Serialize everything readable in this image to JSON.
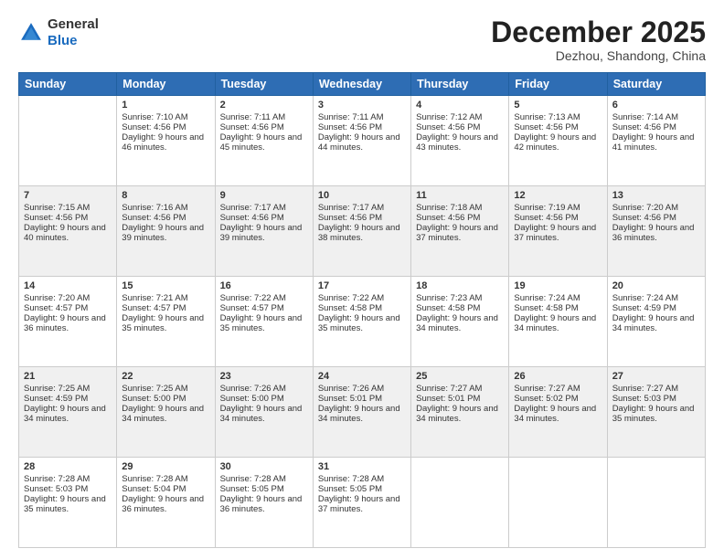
{
  "header": {
    "logo_line1": "General",
    "logo_line2": "Blue",
    "month_title": "December 2025",
    "location": "Dezhou, Shandong, China"
  },
  "days_of_week": [
    "Sunday",
    "Monday",
    "Tuesday",
    "Wednesday",
    "Thursday",
    "Friday",
    "Saturday"
  ],
  "weeks": [
    [
      {
        "day": "",
        "sunrise": "",
        "sunset": "",
        "daylight": ""
      },
      {
        "day": "1",
        "sunrise": "Sunrise: 7:10 AM",
        "sunset": "Sunset: 4:56 PM",
        "daylight": "Daylight: 9 hours and 46 minutes."
      },
      {
        "day": "2",
        "sunrise": "Sunrise: 7:11 AM",
        "sunset": "Sunset: 4:56 PM",
        "daylight": "Daylight: 9 hours and 45 minutes."
      },
      {
        "day": "3",
        "sunrise": "Sunrise: 7:11 AM",
        "sunset": "Sunset: 4:56 PM",
        "daylight": "Daylight: 9 hours and 44 minutes."
      },
      {
        "day": "4",
        "sunrise": "Sunrise: 7:12 AM",
        "sunset": "Sunset: 4:56 PM",
        "daylight": "Daylight: 9 hours and 43 minutes."
      },
      {
        "day": "5",
        "sunrise": "Sunrise: 7:13 AM",
        "sunset": "Sunset: 4:56 PM",
        "daylight": "Daylight: 9 hours and 42 minutes."
      },
      {
        "day": "6",
        "sunrise": "Sunrise: 7:14 AM",
        "sunset": "Sunset: 4:56 PM",
        "daylight": "Daylight: 9 hours and 41 minutes."
      }
    ],
    [
      {
        "day": "7",
        "sunrise": "Sunrise: 7:15 AM",
        "sunset": "Sunset: 4:56 PM",
        "daylight": "Daylight: 9 hours and 40 minutes."
      },
      {
        "day": "8",
        "sunrise": "Sunrise: 7:16 AM",
        "sunset": "Sunset: 4:56 PM",
        "daylight": "Daylight: 9 hours and 39 minutes."
      },
      {
        "day": "9",
        "sunrise": "Sunrise: 7:17 AM",
        "sunset": "Sunset: 4:56 PM",
        "daylight": "Daylight: 9 hours and 39 minutes."
      },
      {
        "day": "10",
        "sunrise": "Sunrise: 7:17 AM",
        "sunset": "Sunset: 4:56 PM",
        "daylight": "Daylight: 9 hours and 38 minutes."
      },
      {
        "day": "11",
        "sunrise": "Sunrise: 7:18 AM",
        "sunset": "Sunset: 4:56 PM",
        "daylight": "Daylight: 9 hours and 37 minutes."
      },
      {
        "day": "12",
        "sunrise": "Sunrise: 7:19 AM",
        "sunset": "Sunset: 4:56 PM",
        "daylight": "Daylight: 9 hours and 37 minutes."
      },
      {
        "day": "13",
        "sunrise": "Sunrise: 7:20 AM",
        "sunset": "Sunset: 4:56 PM",
        "daylight": "Daylight: 9 hours and 36 minutes."
      }
    ],
    [
      {
        "day": "14",
        "sunrise": "Sunrise: 7:20 AM",
        "sunset": "Sunset: 4:57 PM",
        "daylight": "Daylight: 9 hours and 36 minutes."
      },
      {
        "day": "15",
        "sunrise": "Sunrise: 7:21 AM",
        "sunset": "Sunset: 4:57 PM",
        "daylight": "Daylight: 9 hours and 35 minutes."
      },
      {
        "day": "16",
        "sunrise": "Sunrise: 7:22 AM",
        "sunset": "Sunset: 4:57 PM",
        "daylight": "Daylight: 9 hours and 35 minutes."
      },
      {
        "day": "17",
        "sunrise": "Sunrise: 7:22 AM",
        "sunset": "Sunset: 4:58 PM",
        "daylight": "Daylight: 9 hours and 35 minutes."
      },
      {
        "day": "18",
        "sunrise": "Sunrise: 7:23 AM",
        "sunset": "Sunset: 4:58 PM",
        "daylight": "Daylight: 9 hours and 34 minutes."
      },
      {
        "day": "19",
        "sunrise": "Sunrise: 7:24 AM",
        "sunset": "Sunset: 4:58 PM",
        "daylight": "Daylight: 9 hours and 34 minutes."
      },
      {
        "day": "20",
        "sunrise": "Sunrise: 7:24 AM",
        "sunset": "Sunset: 4:59 PM",
        "daylight": "Daylight: 9 hours and 34 minutes."
      }
    ],
    [
      {
        "day": "21",
        "sunrise": "Sunrise: 7:25 AM",
        "sunset": "Sunset: 4:59 PM",
        "daylight": "Daylight: 9 hours and 34 minutes."
      },
      {
        "day": "22",
        "sunrise": "Sunrise: 7:25 AM",
        "sunset": "Sunset: 5:00 PM",
        "daylight": "Daylight: 9 hours and 34 minutes."
      },
      {
        "day": "23",
        "sunrise": "Sunrise: 7:26 AM",
        "sunset": "Sunset: 5:00 PM",
        "daylight": "Daylight: 9 hours and 34 minutes."
      },
      {
        "day": "24",
        "sunrise": "Sunrise: 7:26 AM",
        "sunset": "Sunset: 5:01 PM",
        "daylight": "Daylight: 9 hours and 34 minutes."
      },
      {
        "day": "25",
        "sunrise": "Sunrise: 7:27 AM",
        "sunset": "Sunset: 5:01 PM",
        "daylight": "Daylight: 9 hours and 34 minutes."
      },
      {
        "day": "26",
        "sunrise": "Sunrise: 7:27 AM",
        "sunset": "Sunset: 5:02 PM",
        "daylight": "Daylight: 9 hours and 34 minutes."
      },
      {
        "day": "27",
        "sunrise": "Sunrise: 7:27 AM",
        "sunset": "Sunset: 5:03 PM",
        "daylight": "Daylight: 9 hours and 35 minutes."
      }
    ],
    [
      {
        "day": "28",
        "sunrise": "Sunrise: 7:28 AM",
        "sunset": "Sunset: 5:03 PM",
        "daylight": "Daylight: 9 hours and 35 minutes."
      },
      {
        "day": "29",
        "sunrise": "Sunrise: 7:28 AM",
        "sunset": "Sunset: 5:04 PM",
        "daylight": "Daylight: 9 hours and 36 minutes."
      },
      {
        "day": "30",
        "sunrise": "Sunrise: 7:28 AM",
        "sunset": "Sunset: 5:05 PM",
        "daylight": "Daylight: 9 hours and 36 minutes."
      },
      {
        "day": "31",
        "sunrise": "Sunrise: 7:28 AM",
        "sunset": "Sunset: 5:05 PM",
        "daylight": "Daylight: 9 hours and 37 minutes."
      },
      {
        "day": "",
        "sunrise": "",
        "sunset": "",
        "daylight": ""
      },
      {
        "day": "",
        "sunrise": "",
        "sunset": "",
        "daylight": ""
      },
      {
        "day": "",
        "sunrise": "",
        "sunset": "",
        "daylight": ""
      }
    ]
  ]
}
